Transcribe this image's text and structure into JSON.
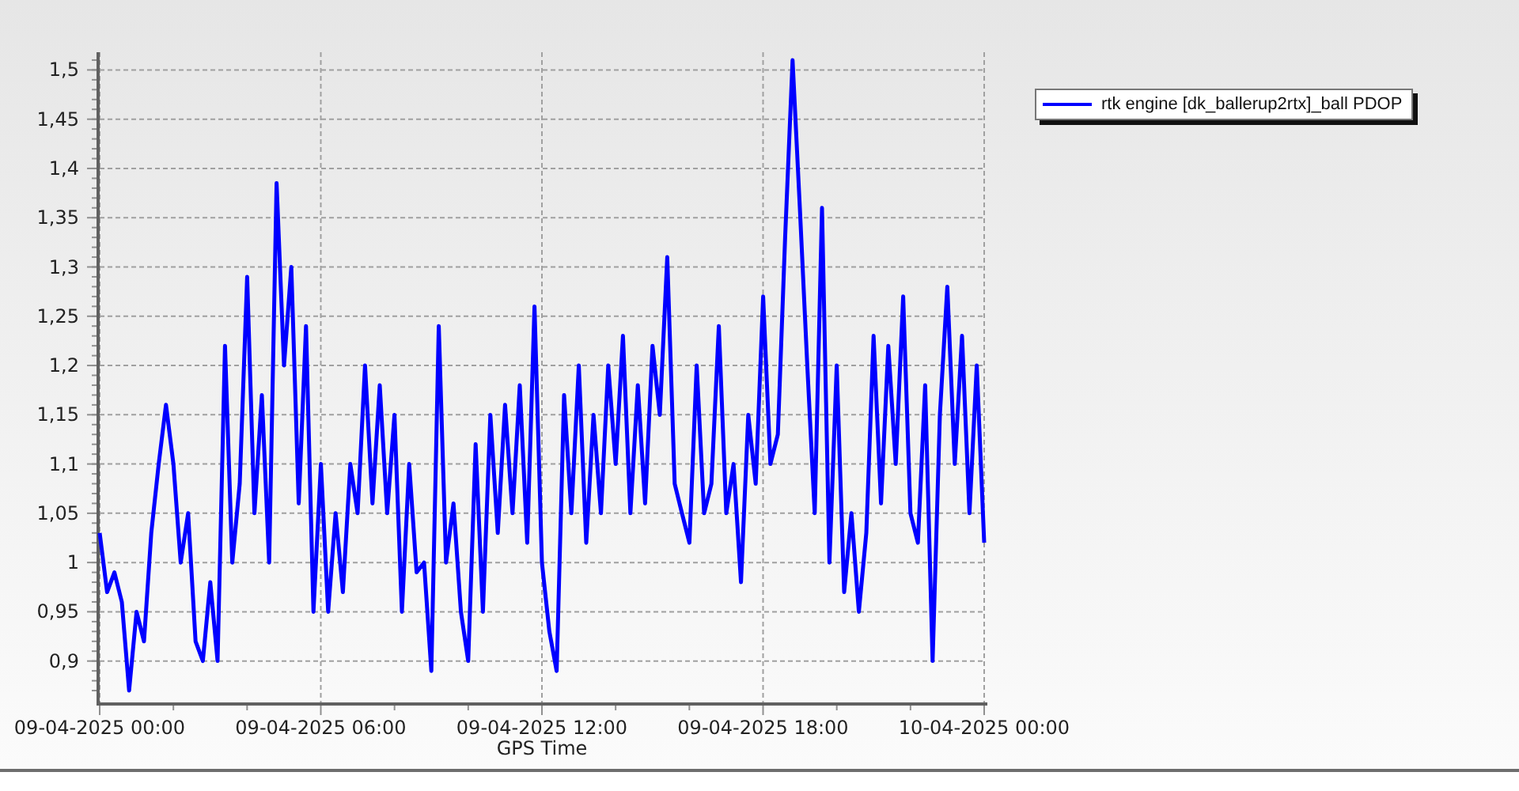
{
  "chart": {
    "chart_data": {
      "type": "line",
      "grid": true,
      "xlabel": "GPS Time",
      "ylim": [
        0.858,
        1.518
      ],
      "yticks": [
        {
          "value": 0.9,
          "label": "0,9"
        },
        {
          "value": 0.95,
          "label": "0,95"
        },
        {
          "value": 1,
          "label": "1"
        },
        {
          "value": 1.05,
          "label": "1,05"
        },
        {
          "value": 1.1,
          "label": "1,1"
        },
        {
          "value": 1.15,
          "label": "1,15"
        },
        {
          "value": 1.2,
          "label": "1,2"
        },
        {
          "value": 1.25,
          "label": "1,25"
        },
        {
          "value": 1.3,
          "label": "1,3"
        },
        {
          "value": 1.35,
          "label": "1,35"
        },
        {
          "value": 1.4,
          "label": "1,4"
        },
        {
          "value": 1.45,
          "label": "1,45"
        },
        {
          "value": 1.5,
          "label": "1,5"
        }
      ],
      "categories": [
        "09-04-2025 00:00",
        null,
        null,
        null,
        null,
        null,
        null,
        null,
        null,
        null,
        null,
        null,
        null,
        null,
        null,
        null,
        null,
        null,
        null,
        null,
        null,
        null,
        null,
        null,
        null,
        null,
        null,
        null,
        null,
        null,
        "09-04-2025 06:00",
        null,
        null,
        null,
        null,
        null,
        null,
        null,
        null,
        null,
        null,
        null,
        null,
        null,
        null,
        null,
        null,
        null,
        null,
        null,
        null,
        null,
        null,
        null,
        null,
        null,
        null,
        null,
        null,
        null,
        "09-04-2025 12:00",
        null,
        null,
        null,
        null,
        null,
        null,
        null,
        null,
        null,
        null,
        null,
        null,
        null,
        null,
        null,
        null,
        null,
        null,
        null,
        null,
        null,
        null,
        null,
        null,
        null,
        null,
        null,
        null,
        null,
        "09-04-2025 18:00",
        null,
        null,
        null,
        null,
        null,
        null,
        null,
        null,
        null,
        null,
        null,
        null,
        null,
        null,
        null,
        null,
        null,
        null,
        null,
        null,
        null,
        null,
        null,
        null,
        null,
        null,
        null,
        null,
        null,
        "10-04-2025 00:00"
      ],
      "series": [
        {
          "name": "rtk engine [dk_ballerup2rtx]_ball PDOP",
          "color": "#0000ff",
          "values": [
            1.03,
            0.97,
            0.99,
            0.96,
            0.87,
            0.95,
            0.92,
            1.03,
            1.1,
            1.16,
            1.1,
            1.0,
            1.05,
            0.92,
            0.9,
            0.98,
            0.9,
            1.22,
            1.0,
            1.08,
            1.29,
            1.05,
            1.17,
            1.0,
            1.385,
            1.2,
            1.3,
            1.06,
            1.24,
            0.95,
            1.1,
            0.95,
            1.05,
            0.97,
            1.1,
            1.05,
            1.2,
            1.06,
            1.18,
            1.05,
            1.15,
            0.95,
            1.1,
            0.99,
            1.0,
            0.89,
            1.24,
            1.0,
            1.06,
            0.95,
            0.9,
            1.12,
            0.95,
            1.15,
            1.03,
            1.16,
            1.05,
            1.18,
            1.02,
            1.26,
            1.0,
            0.93,
            0.89,
            1.17,
            1.05,
            1.2,
            1.02,
            1.15,
            1.05,
            1.2,
            1.1,
            1.23,
            1.05,
            1.18,
            1.06,
            1.22,
            1.15,
            1.31,
            1.08,
            1.05,
            1.02,
            1.2,
            1.05,
            1.08,
            1.24,
            1.05,
            1.1,
            0.98,
            1.15,
            1.08,
            1.27,
            1.1,
            1.13,
            1.33,
            1.51,
            1.36,
            1.2,
            1.05,
            1.36,
            1.0,
            1.2,
            0.97,
            1.05,
            0.95,
            1.03,
            1.23,
            1.06,
            1.22,
            1.1,
            1.27,
            1.05,
            1.02,
            1.18,
            0.9,
            1.15,
            1.28,
            1.1,
            1.23,
            1.05,
            1.2,
            1.02
          ]
        }
      ]
    }
  }
}
